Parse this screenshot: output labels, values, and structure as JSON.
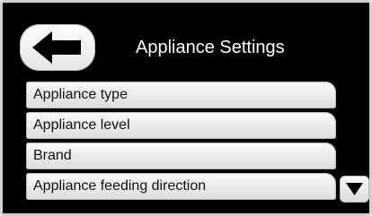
{
  "header": {
    "title": "Appliance Settings",
    "back_icon": "left-arrow-icon"
  },
  "menu": {
    "items": [
      {
        "label": "Appliance type"
      },
      {
        "label": "Appliance level"
      },
      {
        "label": "Brand"
      },
      {
        "label": "Appliance feeding direction"
      }
    ]
  },
  "scroll": {
    "down_icon": "down-triangle-icon"
  },
  "colors": {
    "screen_background": "#000000",
    "title_text": "#ffffff",
    "button_face": "#eeeeee",
    "button_text": "#111111"
  }
}
